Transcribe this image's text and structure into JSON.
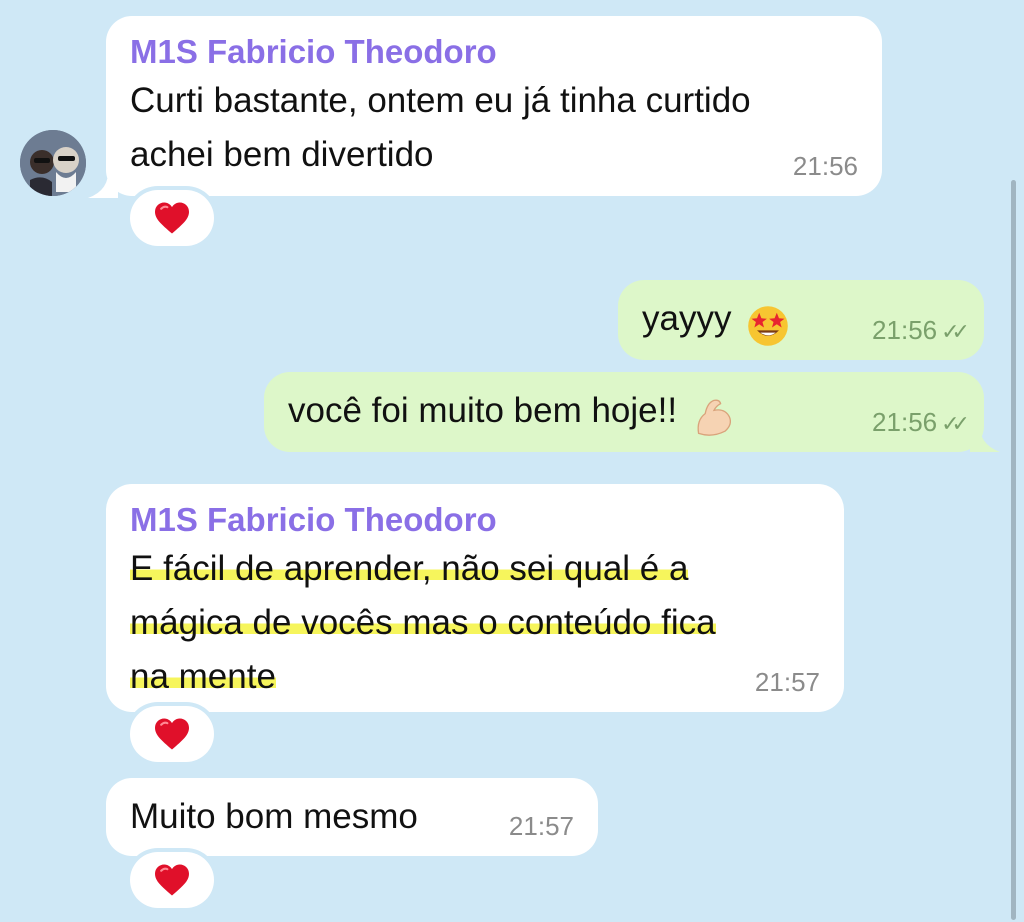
{
  "colors": {
    "background": "#cfe8f6",
    "incoming": "#ffffff",
    "outgoing": "#ddf7c9",
    "sender": "#8a6fe6",
    "highlight": "#f6f55c",
    "heart": "#e0102a"
  },
  "messages": [
    {
      "direction": "in",
      "sender": "M1S Fabricio Theodoro",
      "line1": "Curti bastante, ontem eu já tinha curtido",
      "line2": "achei bem divertido",
      "time": "21:56",
      "reaction": "heart-icon"
    },
    {
      "direction": "out",
      "text": "yayyy",
      "emoji": "star-struck-emoji",
      "time": "21:56",
      "status": "read-double-check"
    },
    {
      "direction": "out",
      "text": "você foi muito bem hoje!!",
      "emoji": "flexed-biceps-emoji",
      "time": "21:56",
      "status": "read-double-check"
    },
    {
      "direction": "in",
      "sender": "M1S Fabricio Theodoro",
      "line1": "E fácil de aprender, não sei qual é a",
      "line2": "mágica de vocês mas o conteúdo fica",
      "line3": "na mente",
      "time": "21:57",
      "reaction": "heart-icon"
    },
    {
      "direction": "in",
      "text": "Muito bom mesmo",
      "time": "21:57",
      "reaction": "heart-icon"
    }
  ]
}
